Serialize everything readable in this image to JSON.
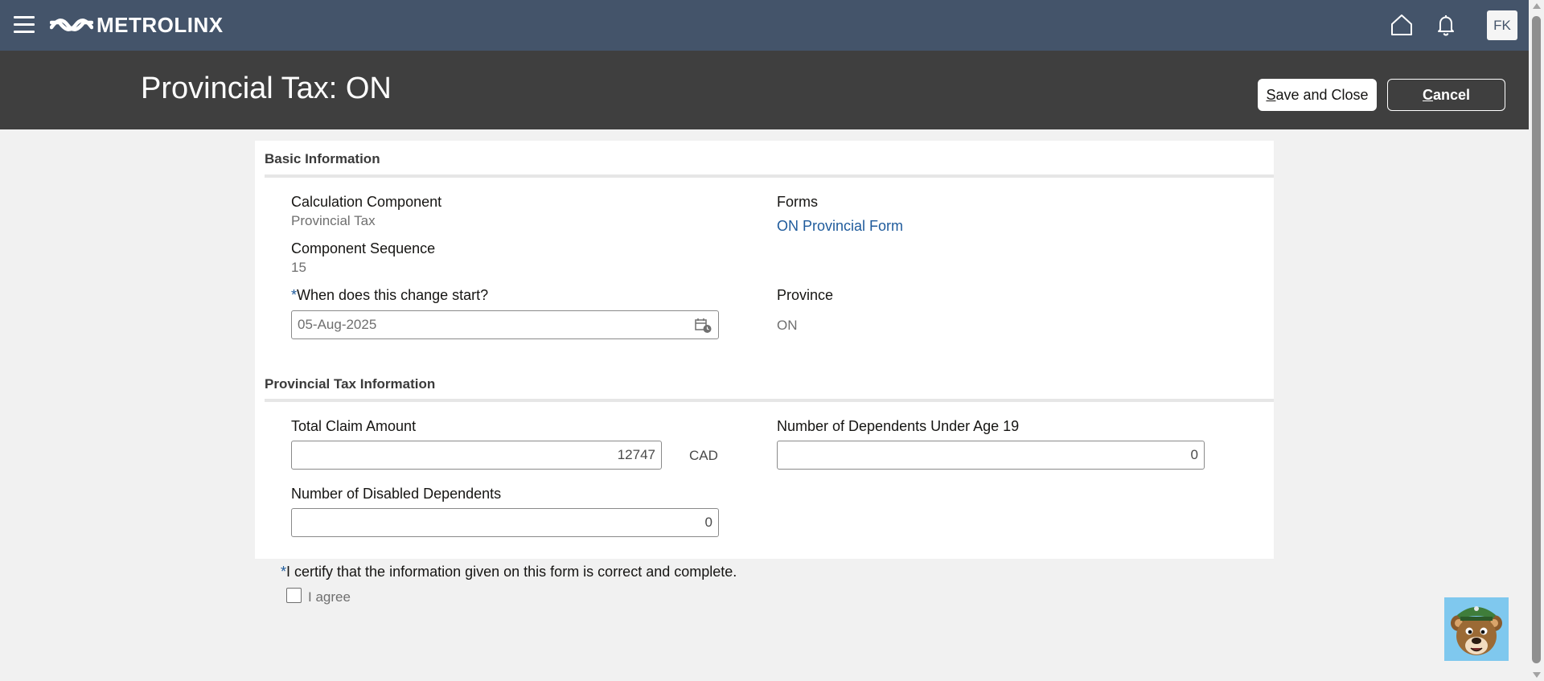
{
  "header": {
    "brand": "METROLINX",
    "avatar_initials": "FK",
    "icons": [
      "menu-icon",
      "home-icon",
      "bell-icon"
    ]
  },
  "titlebar": {
    "title": "Provincial Tax: ON",
    "save_label_first": "S",
    "save_label_rest": "ave and Close",
    "cancel_label_first": "C",
    "cancel_label_rest": "ancel"
  },
  "basic_info": {
    "header": "Basic Information",
    "calc_component_label": "Calculation Component",
    "calc_component_value": "Provincial Tax",
    "component_sequence_label": "Component Sequence",
    "component_sequence_value": "15",
    "change_start_required_mark": "*",
    "change_start_label": "When does this change start?",
    "change_start_value": "05-Aug-2025",
    "forms_label": "Forms",
    "forms_link": "ON Provincial Form",
    "province_label": "Province",
    "province_value": "ON"
  },
  "tax_info": {
    "header": "Provincial Tax Information",
    "total_claim_label": "Total Claim Amount",
    "total_claim_value": "12747",
    "total_claim_currency": "CAD",
    "dependents_under_19_label": "Number of Dependents Under Age 19",
    "dependents_under_19_value": "0",
    "disabled_dependents_label": "Number of Disabled Dependents",
    "disabled_dependents_value": "0"
  },
  "certification": {
    "required_mark": "*",
    "statement": "I certify that the information given on this form is correct and complete.",
    "agree_label": "I agree",
    "agree_checked": false
  },
  "colors": {
    "topbar": "#44546a",
    "titlebar": "#3f3f3f",
    "link": "#1f5b9c",
    "background": "#f1f1f1"
  }
}
